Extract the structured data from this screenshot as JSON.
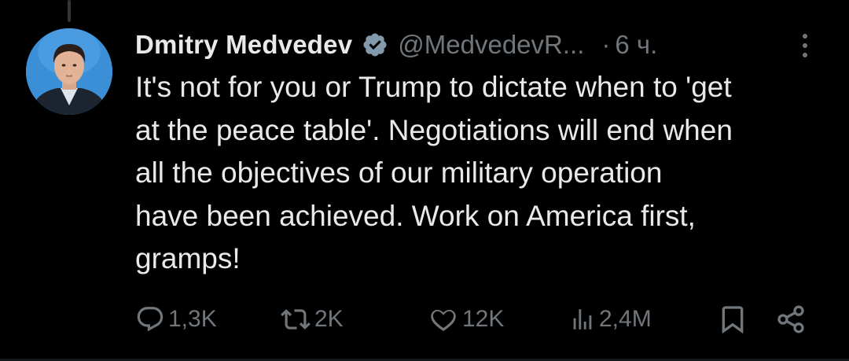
{
  "tweet": {
    "author_name": "Dmitry Medvedev",
    "handle": "@MedvedevR...",
    "separator": "·",
    "time": "6 ч.",
    "text": "It's not for you or Trump to dictate when to 'get\nat the peace table'. Negotiations will end when\nall the objectives of our military operation\nhave been achieved. Work on America first,\ngramps!"
  },
  "actions": {
    "replies": "1,3K",
    "reposts": "2K",
    "likes": "12K",
    "views": "2,4M"
  },
  "icons": {
    "verified": "verified-badge-icon",
    "more": "more-vertical-icon",
    "reply": "reply-icon",
    "repost": "repost-icon",
    "like": "heart-icon",
    "views": "views-chart-icon",
    "bookmark": "bookmark-icon",
    "share": "share-icon"
  },
  "colors": {
    "background": "#000000",
    "text_primary": "#e7e9ea",
    "text_secondary": "#71767b",
    "verified_badge": "#829aab"
  }
}
